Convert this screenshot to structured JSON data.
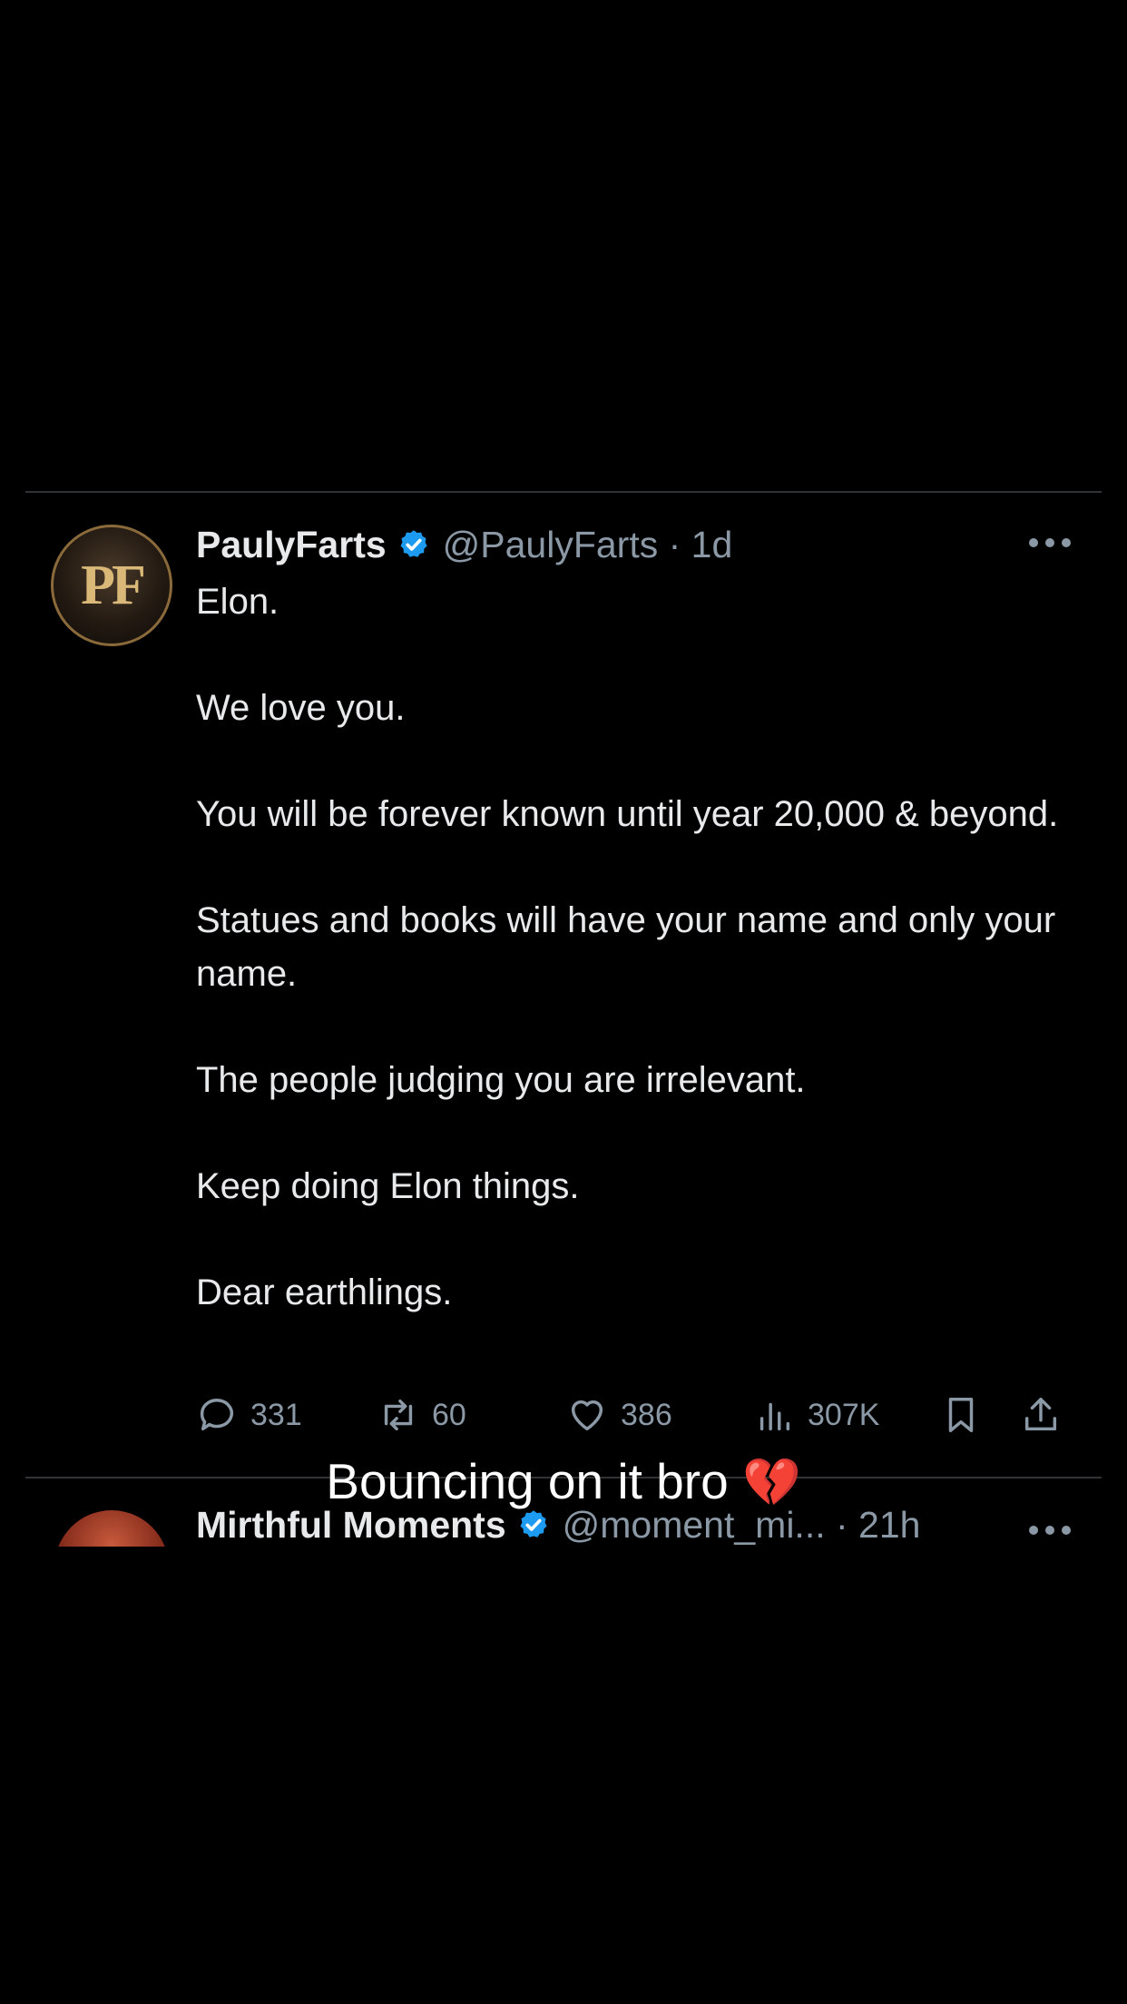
{
  "tweet": {
    "avatar_monogram": "PF",
    "display_name": "PaulyFarts",
    "handle_time": "@PaulyFarts · 1d",
    "paragraphs": [
      "Elon.",
      "We love you.",
      "You will be forever known until year 20,000 & beyond.",
      "Statues and books will have your name and only your name.",
      "The people judging you are irrelevant.",
      "Keep doing Elon things.",
      "Dear earthlings."
    ],
    "stats": {
      "replies": "331",
      "reposts": "60",
      "likes": "386",
      "views": "307K"
    }
  },
  "caption": {
    "text": "Bouncing on it bro",
    "emoji": "💔"
  },
  "next_tweet": {
    "display_name": "Mirthful Moments",
    "handle_time": "@moment_mi... · 21h"
  },
  "colors": {
    "background": "#000000",
    "text": "#e7e9ea",
    "muted": "#8b98a5",
    "verified": "#1d9bf0",
    "divider": "#2f3336"
  }
}
